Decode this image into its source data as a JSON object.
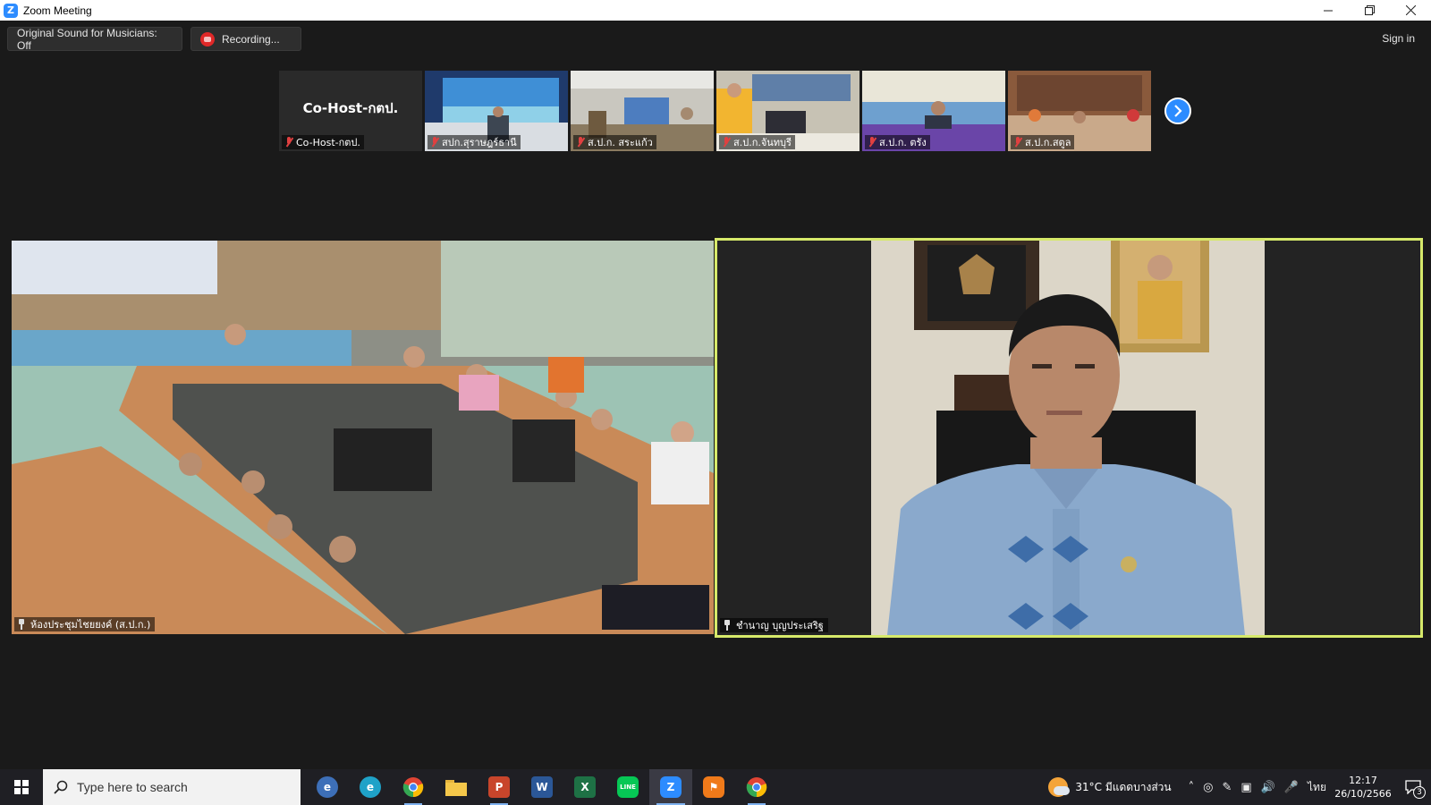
{
  "window": {
    "title": "Zoom Meeting"
  },
  "toolbar": {
    "original_sound": "Original Sound for Musicians: Off",
    "recording": "Recording...",
    "sign_in": "Sign in"
  },
  "thumbnails": [
    {
      "label": "Co-Host-กตป.",
      "center_name": "Co-Host-กตป.",
      "muted": true
    },
    {
      "label": "สปก.สุราษฎร์ธานี",
      "muted": true
    },
    {
      "label": "ส.ป.ก. สระแก้ว",
      "muted": true
    },
    {
      "label": "ส.ป.ก.จันทบุรี",
      "muted": true
    },
    {
      "label": "ส.ป.ก. ตรัง",
      "muted": true
    },
    {
      "label": "ส.ป.ก.สตูล",
      "muted": true
    }
  ],
  "main_videos": [
    {
      "label": "ห้องประชุมไชยยงค์ (ส.ป.ก.)",
      "pinned": true
    },
    {
      "label": "ชำนาญ บุญประเสริฐ",
      "pinned": true,
      "speaking": true
    }
  ],
  "taskbar": {
    "search_placeholder": "Type here to search",
    "apps": [
      {
        "name": "browser-app",
        "letter": "e"
      },
      {
        "name": "edge",
        "letter": "e"
      },
      {
        "name": "chrome",
        "letter": ""
      },
      {
        "name": "file-explorer",
        "letter": ""
      },
      {
        "name": "powerpoint",
        "letter": "P"
      },
      {
        "name": "word",
        "letter": "W"
      },
      {
        "name": "excel",
        "letter": "X"
      },
      {
        "name": "line",
        "letter": "LINE"
      },
      {
        "name": "zoom",
        "letter": "Z"
      },
      {
        "name": "app-orange",
        "letter": ""
      },
      {
        "name": "chrome-2",
        "letter": ""
      }
    ],
    "weather": "31°C มีแดดบางส่วน",
    "language": "ไทย",
    "time": "12:17",
    "date": "26/10/2566",
    "notification_count": "3"
  },
  "colors": {
    "zoom_blue": "#2d8cff",
    "speaker_border": "#d6e96a",
    "recording_red": "#e02828",
    "mute_red": "#e04040"
  }
}
